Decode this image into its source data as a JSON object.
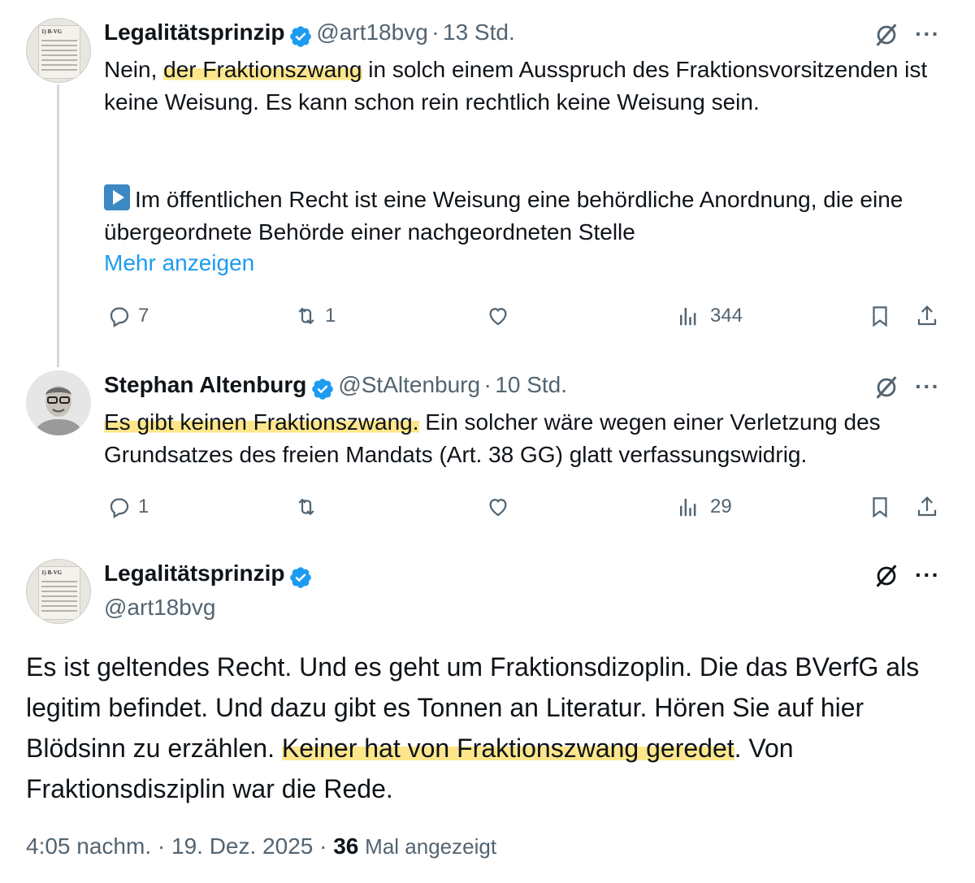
{
  "tweets": [
    {
      "name": "Legalitätsprinzip",
      "handle": "@art18bvg",
      "sep": "·",
      "time": "13 Std.",
      "avatar_text": "1) B-VG",
      "text_pre": "Nein, ",
      "text_hl": "der Fraktionszwang",
      "text_post": " in solch einem Ausspruch des Fraktionsvorsitzenden ist keine Weisung. Es kann schon rein rechtlich keine Weisung sein.",
      "text_para2": "Im öffentlichen Recht ist eine Weisung eine behördliche Anordnung, die eine übergeordnete Behörde einer nachgeordneten Stelle",
      "para2_icon": "play-button-emoji",
      "more_link": "Mehr anzeigen",
      "replies": "7",
      "retweets": "1",
      "likes": "",
      "views": "344"
    },
    {
      "name": "Stephan Altenburg",
      "handle": "@StAltenburg",
      "sep": "·",
      "time": "10 Std.",
      "text_hl": "Es gibt keinen Fraktionszwang.",
      "text_post": " Ein solcher wäre wegen einer Verletzung des Grundsatzes des freien Mandats (Art. 38 GG) glatt verfassungswidrig.",
      "replies": "1",
      "retweets": "",
      "likes": "",
      "views": "29"
    }
  ],
  "main": {
    "name": "Legalitätsprinzip",
    "handle": "@art18bvg",
    "avatar_text": "1) B-VG",
    "text_pre": "Es ist geltendes Recht. Und es geht um Fraktionsdizoplin. Die das BVerfG als legitim befindet. Und dazu gibt es Tonnen an Literatur. Hören Sie auf hier Blödsinn zu erzählen. ",
    "text_hl": "Keiner hat von Fraktionszwang geredet",
    "text_post": ". Von Fraktionsdisziplin war die Rede.",
    "time": "4:05 nachm.",
    "sep": "·",
    "date": "19. Dez. 2025",
    "views_count": "36",
    "views_label": "Mal angezeigt"
  },
  "menu_label": "···",
  "colors": {
    "accent": "#1d9bf0",
    "highlight": "#fde68a",
    "muted": "#536471",
    "text": "#0f1419"
  },
  "icons": [
    "verified-badge-icon",
    "grok-icon",
    "more-icon",
    "reply-icon",
    "retweet-icon",
    "like-icon",
    "views-icon",
    "bookmark-icon",
    "share-icon"
  ]
}
